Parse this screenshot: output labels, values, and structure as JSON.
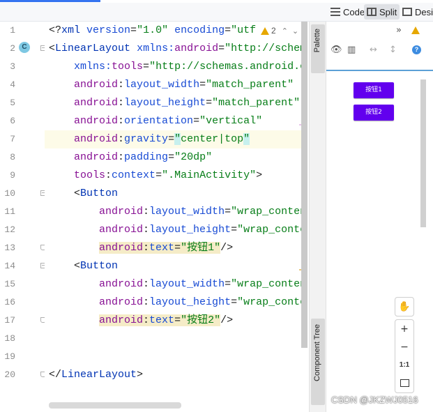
{
  "toolbar": {
    "views": [
      {
        "label": "Code"
      },
      {
        "label": "Split"
      },
      {
        "label": "Desig"
      }
    ]
  },
  "gutter": {
    "line_numbers": [
      "1",
      "2",
      "3",
      "4",
      "5",
      "6",
      "7",
      "8",
      "9",
      "10",
      "11",
      "12",
      "13",
      "14",
      "15",
      "16",
      "17",
      "18",
      "19",
      "20"
    ],
    "class_badge": "C"
  },
  "editor": {
    "warning_count": "2",
    "lines": [
      [
        {
          "t": "<?",
          "c": "punc"
        },
        {
          "t": "xml ",
          "c": "tag"
        },
        {
          "t": "version",
          "c": "attr"
        },
        {
          "t": "=",
          "c": "punc"
        },
        {
          "t": "\"1.0\"",
          "c": "val"
        },
        {
          "t": " ",
          "c": "punc"
        },
        {
          "t": "encoding",
          "c": "attr"
        },
        {
          "t": "=",
          "c": "punc"
        },
        {
          "t": "\"utf",
          "c": "val"
        }
      ],
      [
        {
          "t": "<",
          "c": "punc"
        },
        {
          "t": "LinearLayout",
          "c": "tag"
        },
        {
          "t": " ",
          "c": "punc"
        },
        {
          "t": "xmlns:",
          "c": "attr"
        },
        {
          "t": "android",
          "c": "ns"
        },
        {
          "t": "=",
          "c": "punc"
        },
        {
          "t": "\"http://schema",
          "c": "val"
        }
      ],
      [
        {
          "t": "    ",
          "c": "punc"
        },
        {
          "t": "xmlns:",
          "c": "attr"
        },
        {
          "t": "tools",
          "c": "ns"
        },
        {
          "t": "=",
          "c": "punc"
        },
        {
          "t": "\"http://schemas.android.co",
          "c": "val"
        }
      ],
      [
        {
          "t": "    ",
          "c": "punc"
        },
        {
          "t": "android",
          "c": "ns"
        },
        {
          "t": ":",
          "c": "punc"
        },
        {
          "t": "layout_width",
          "c": "attr"
        },
        {
          "t": "=",
          "c": "punc"
        },
        {
          "t": "\"match_parent\"",
          "c": "val"
        }
      ],
      [
        {
          "t": "    ",
          "c": "punc"
        },
        {
          "t": "android",
          "c": "ns"
        },
        {
          "t": ":",
          "c": "punc"
        },
        {
          "t": "layout_height",
          "c": "attr"
        },
        {
          "t": "=",
          "c": "punc"
        },
        {
          "t": "\"match_parent\"",
          "c": "val"
        }
      ],
      [
        {
          "t": "    ",
          "c": "punc"
        },
        {
          "t": "android",
          "c": "ns"
        },
        {
          "t": ":",
          "c": "punc"
        },
        {
          "t": "orientation",
          "c": "attr"
        },
        {
          "t": "=",
          "c": "punc"
        },
        {
          "t": "\"vertical\"",
          "c": "val"
        }
      ],
      [
        {
          "t": "    ",
          "c": "punc"
        },
        {
          "t": "android",
          "c": "ns"
        },
        {
          "t": ":",
          "c": "punc"
        },
        {
          "t": "gravity",
          "c": "attr"
        },
        {
          "t": "=",
          "c": "punc"
        },
        {
          "t": "\"",
          "c": "val hl2"
        },
        {
          "t": "center|top",
          "c": "val"
        },
        {
          "t": "\"",
          "c": "val hl2"
        }
      ],
      [
        {
          "t": "    ",
          "c": "punc"
        },
        {
          "t": "android",
          "c": "ns"
        },
        {
          "t": ":",
          "c": "punc"
        },
        {
          "t": "padding",
          "c": "attr"
        },
        {
          "t": "=",
          "c": "punc"
        },
        {
          "t": "\"20dp\"",
          "c": "val"
        }
      ],
      [
        {
          "t": "    ",
          "c": "punc"
        },
        {
          "t": "tools",
          "c": "ns"
        },
        {
          "t": ":",
          "c": "punc"
        },
        {
          "t": "context",
          "c": "attr"
        },
        {
          "t": "=",
          "c": "punc"
        },
        {
          "t": "\".MainActivity\"",
          "c": "val"
        },
        {
          "t": ">",
          "c": "punc"
        }
      ],
      [
        {
          "t": "    <",
          "c": "punc"
        },
        {
          "t": "Button",
          "c": "tag"
        }
      ],
      [
        {
          "t": "        ",
          "c": "punc"
        },
        {
          "t": "android",
          "c": "ns"
        },
        {
          "t": ":",
          "c": "punc"
        },
        {
          "t": "layout_width",
          "c": "attr"
        },
        {
          "t": "=",
          "c": "punc"
        },
        {
          "t": "\"wrap_content",
          "c": "val"
        }
      ],
      [
        {
          "t": "        ",
          "c": "punc"
        },
        {
          "t": "android",
          "c": "ns"
        },
        {
          "t": ":",
          "c": "punc"
        },
        {
          "t": "layout_height",
          "c": "attr"
        },
        {
          "t": "=",
          "c": "punc"
        },
        {
          "t": "\"wrap_conten",
          "c": "val"
        }
      ],
      [
        {
          "t": "        ",
          "c": "punc"
        },
        {
          "t": "android",
          "c": "ns hl"
        },
        {
          "t": ":",
          "c": "punc hl"
        },
        {
          "t": "text",
          "c": "attr hl"
        },
        {
          "t": "=",
          "c": "punc hl"
        },
        {
          "t": "\"按钮1\"",
          "c": "val hl"
        },
        {
          "t": "/>",
          "c": "punc"
        }
      ],
      [
        {
          "t": "    <",
          "c": "punc"
        },
        {
          "t": "Button",
          "c": "tag"
        }
      ],
      [
        {
          "t": "        ",
          "c": "punc"
        },
        {
          "t": "android",
          "c": "ns"
        },
        {
          "t": ":",
          "c": "punc"
        },
        {
          "t": "layout_width",
          "c": "attr"
        },
        {
          "t": "=",
          "c": "punc"
        },
        {
          "t": "\"wrap_content",
          "c": "val"
        }
      ],
      [
        {
          "t": "        ",
          "c": "punc"
        },
        {
          "t": "android",
          "c": "ns"
        },
        {
          "t": ":",
          "c": "punc"
        },
        {
          "t": "layout_height",
          "c": "attr"
        },
        {
          "t": "=",
          "c": "punc"
        },
        {
          "t": "\"wrap_conten",
          "c": "val"
        }
      ],
      [
        {
          "t": "        ",
          "c": "punc"
        },
        {
          "t": "android",
          "c": "ns hl"
        },
        {
          "t": ":",
          "c": "punc hl"
        },
        {
          "t": "text",
          "c": "attr hl"
        },
        {
          "t": "=",
          "c": "punc hl"
        },
        {
          "t": "\"按钮2\"",
          "c": "val hl"
        },
        {
          "t": "/>",
          "c": "punc"
        }
      ],
      [],
      [],
      [
        {
          "t": "</",
          "c": "punc"
        },
        {
          "t": "LinearLayout",
          "c": "tag"
        },
        {
          "t": ">",
          "c": "punc"
        }
      ]
    ]
  },
  "side_tabs": {
    "palette": "Palette",
    "component_tree": "Component Tree"
  },
  "design": {
    "buttons": [
      "按钮1",
      "按钮2"
    ],
    "zoom_ratio": "1:1",
    "zoom_in": "+",
    "zoom_out": "−",
    "info": "?"
  },
  "watermark": "CSDN @JKZWJ0516"
}
